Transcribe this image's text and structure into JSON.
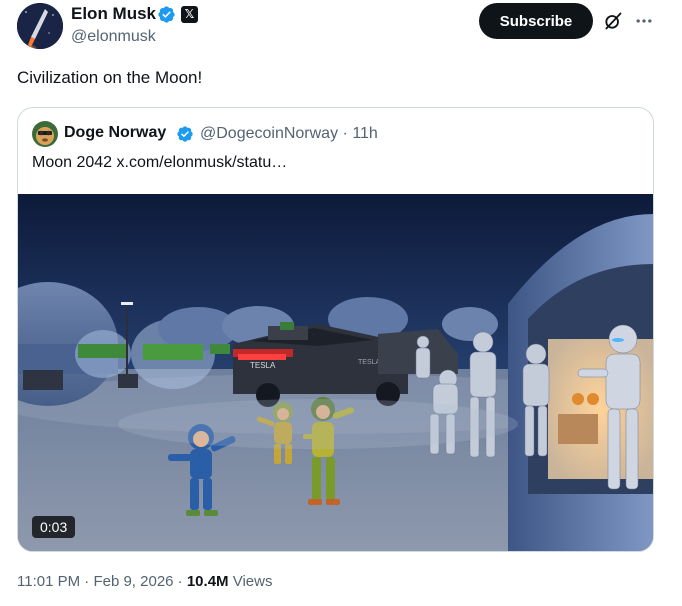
{
  "author": {
    "name": "Elon Musk",
    "handle": "@elonmusk",
    "avatar_icon": "rocket-launch-avatar",
    "verified_icon": "verified-badge-icon",
    "affiliate_icon": "x-logo-badge-icon"
  },
  "actions": {
    "subscribe_label": "Subscribe",
    "grok_icon": "grok-icon",
    "more_icon": "more-dots-icon"
  },
  "post": {
    "text": "Civilization on the Moon!"
  },
  "quote": {
    "name": "Doge Norway",
    "handle": "@DogecoinNorway",
    "separator": "·",
    "time": "11h",
    "text": "Moon 2042  x.com/elonmusk/statu…",
    "video_duration": "0:03"
  },
  "footer": {
    "time": "11:01 PM",
    "separator": "·",
    "date": "Feb 9, 2026",
    "views_count": "10.4M",
    "views_label": "Views"
  },
  "colors": {
    "text": "#0f1419",
    "secondary": "#536471",
    "verified": "#1d9bf0",
    "border": "#cfd9de"
  },
  "video_text": {
    "cybertruck_logo": "TESLA",
    "cybertruck_side_logo": "TESLA"
  }
}
